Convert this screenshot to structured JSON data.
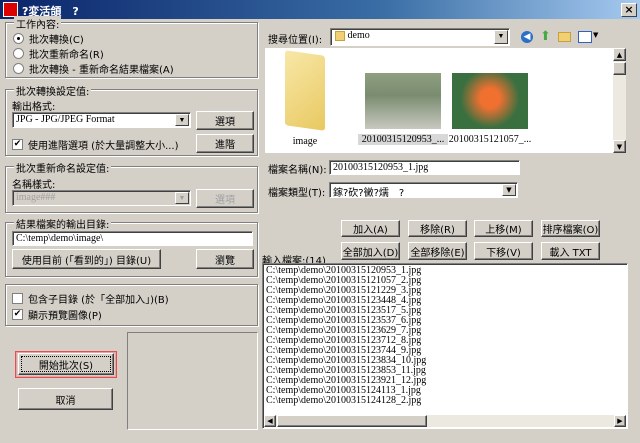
{
  "window": {
    "title": "?変活頜　?",
    "close": "×"
  },
  "work": {
    "legend": "工作內容:",
    "options": [
      "批次轉換(C)",
      "批次重新命名(R)",
      "批次轉換 - 重新命名結果檔案(A)"
    ],
    "selected": 0
  },
  "convert": {
    "legend": "批次轉換設定值:",
    "format_label": "輸出格式:",
    "format_value": "JPG - JPG/JPEG Format",
    "options_button": "選項",
    "advanced_check": "使用進階選項 (於大量調整大小...)",
    "advanced_checked": true,
    "advanced_button": "進階"
  },
  "rename": {
    "legend": "批次重新命名設定值:",
    "pattern_label": "名稱樣式:",
    "pattern_value": "image###",
    "options_button": "選項"
  },
  "output": {
    "legend": "結果檔案的輸出目錄:",
    "path": "C:\\temp\\demo\\image\\",
    "use_current_button": "使用目前 (「看到的」) 目錄(U)",
    "browse_button": "瀏覽"
  },
  "flags": {
    "include_sub": "包含子目錄 (於「全部加入」)(B)",
    "include_sub_checked": false,
    "show_preview": "顯示預覽圖像(P)",
    "show_preview_checked": true
  },
  "actions": {
    "start": "開始批次(S)",
    "cancel": "取消"
  },
  "browser": {
    "look_in_label": "搜尋位置(I):",
    "look_in_value": "demo",
    "items": [
      {
        "name": "image",
        "type": "folder"
      },
      {
        "name": "20100315120953_...",
        "type": "image",
        "selected": true
      },
      {
        "name": "20100315121057_...",
        "type": "image"
      }
    ],
    "filename_label": "檔案名稱(N):",
    "filename_value": "20100315120953_1.jpg",
    "filetype_label": "檔案類型(T):",
    "filetype_value": "鎵?砍?黴?燸　?"
  },
  "buttons": [
    "加入(A)",
    "移除(R)",
    "上移(M)",
    "排序檔案(O)",
    "全部加入(D)",
    "全部移除(E)",
    "下移(V)",
    "載入 TXT"
  ],
  "input": {
    "label": "輸入檔案:(14)",
    "files": [
      "C:\\temp\\demo\\20100315120953_1.jpg",
      "C:\\temp\\demo\\20100315121057_2.jpg",
      "C:\\temp\\demo\\20100315121229_3.jpg",
      "C:\\temp\\demo\\20100315123448_4.jpg",
      "C:\\temp\\demo\\20100315123517_5.jpg",
      "C:\\temp\\demo\\20100315123537_6.jpg",
      "C:\\temp\\demo\\20100315123629_7.jpg",
      "C:\\temp\\demo\\20100315123712_8.jpg",
      "C:\\temp\\demo\\20100315123744_9.jpg",
      "C:\\temp\\demo\\20100315123834_10.jpg",
      "C:\\temp\\demo\\20100315123853_11.jpg",
      "C:\\temp\\demo\\20100315123921_12.jpg",
      "C:\\temp\\demo\\20100315124113_1.jpg",
      "C:\\temp\\demo\\20100315124128_2.jpg"
    ]
  },
  "colors": {
    "title_bar": "#0a246a",
    "focus_border": "#e05050"
  }
}
